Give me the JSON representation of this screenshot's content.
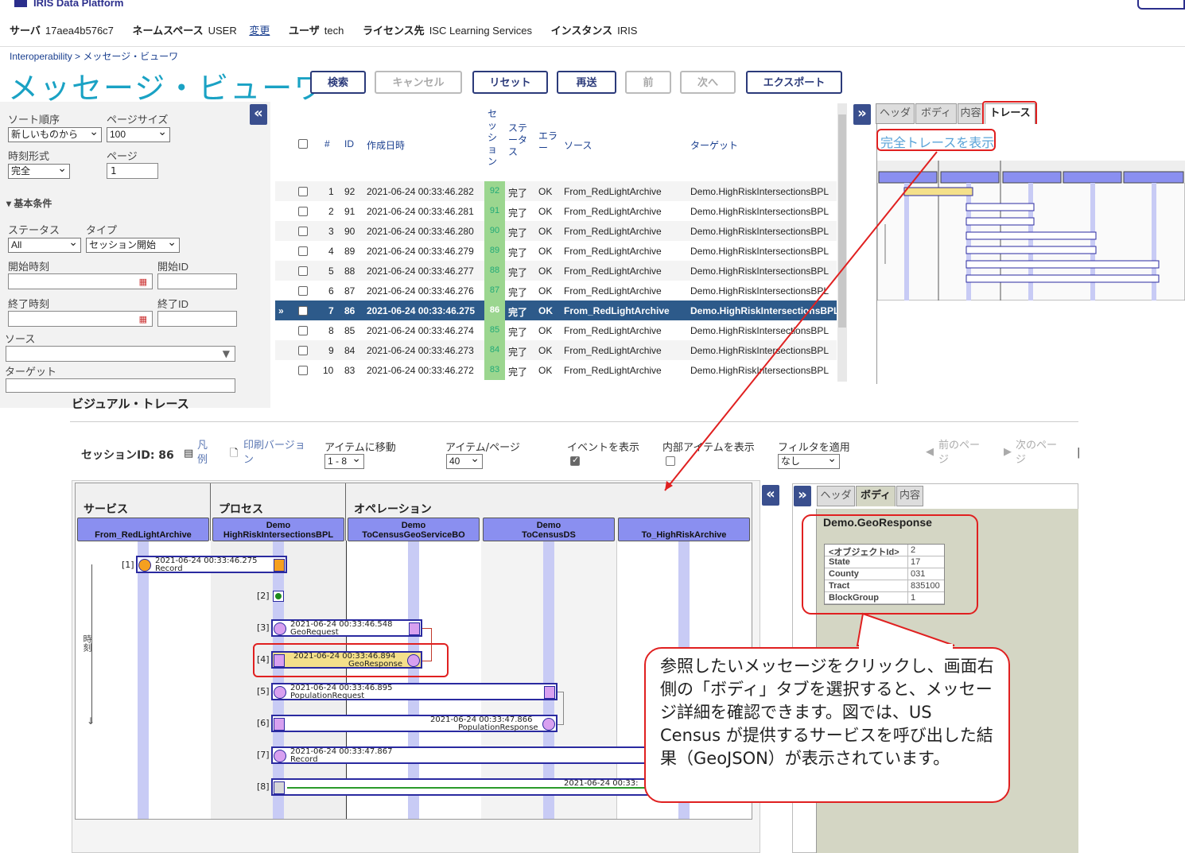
{
  "header": {
    "brand": "IRIS Data Platform",
    "server_label": "サーバ",
    "server": "17aea4b576c7",
    "namespace_label": "ネームスペース",
    "namespace": "USER",
    "change_link": "変更",
    "user_label": "ユーザ",
    "user": "tech",
    "license_label": "ライセンス先",
    "license": "ISC Learning Services",
    "instance_label": "インスタンス",
    "instance": "IRIS"
  },
  "breadcrumb": "Interoperability > メッセージ・ビューワ",
  "page_title": "メッセージ・ビューワ",
  "toolbar": {
    "search": "検索",
    "cancel": "キャンセル",
    "reset": "リセット",
    "resend": "再送",
    "prev": "前",
    "next": "次へ",
    "export": "エクスポート"
  },
  "filters": {
    "sort_label": "ソート順序",
    "sort_value": "新しいものから",
    "pagesize_label": "ページサイズ",
    "pagesize_value": "100",
    "timeformat_label": "時刻形式",
    "timeformat_value": "完全",
    "page_label": "ページ",
    "page_value": "1",
    "basic_section": "基本条件",
    "status_label": "ステータス",
    "status_value": "All",
    "type_label": "タイプ",
    "type_value": "セッション開始",
    "start_time_label": "開始時刻",
    "start_id_label": "開始ID",
    "end_time_label": "終了時刻",
    "end_id_label": "終了ID",
    "source_label": "ソース",
    "target_label": "ターゲット"
  },
  "table": {
    "headers": {
      "num": "#",
      "id": "ID",
      "created": "作成日時",
      "session": "セ ッ シ ョ ン",
      "status": "ステ ータ ス",
      "error": "エラ ー",
      "source": "ソース",
      "target": "ターゲット"
    },
    "rows": [
      {
        "num": "1",
        "id": "92",
        "time": "2021-06-24 00:33:46.282",
        "session": "92",
        "status": "完了",
        "error": "OK",
        "source": "From_RedLightArchive",
        "target": "Demo.HighRiskIntersectionsBPL"
      },
      {
        "num": "2",
        "id": "91",
        "time": "2021-06-24 00:33:46.281",
        "session": "91",
        "status": "完了",
        "error": "OK",
        "source": "From_RedLightArchive",
        "target": "Demo.HighRiskIntersectionsBPL"
      },
      {
        "num": "3",
        "id": "90",
        "time": "2021-06-24 00:33:46.280",
        "session": "90",
        "status": "完了",
        "error": "OK",
        "source": "From_RedLightArchive",
        "target": "Demo.HighRiskIntersectionsBPL"
      },
      {
        "num": "4",
        "id": "89",
        "time": "2021-06-24 00:33:46.279",
        "session": "89",
        "status": "完了",
        "error": "OK",
        "source": "From_RedLightArchive",
        "target": "Demo.HighRiskIntersectionsBPL"
      },
      {
        "num": "5",
        "id": "88",
        "time": "2021-06-24 00:33:46.277",
        "session": "88",
        "status": "完了",
        "error": "OK",
        "source": "From_RedLightArchive",
        "target": "Demo.HighRiskIntersectionsBPL"
      },
      {
        "num": "6",
        "id": "87",
        "time": "2021-06-24 00:33:46.276",
        "session": "87",
        "status": "完了",
        "error": "OK",
        "source": "From_RedLightArchive",
        "target": "Demo.HighRiskIntersectionsBPL"
      },
      {
        "num": "7",
        "id": "86",
        "time": "2021-06-24 00:33:46.275",
        "session": "86",
        "status": "完了",
        "error": "OK",
        "source": "From_RedLightArchive",
        "target": "Demo.HighRiskIntersectionsBPL",
        "selected": true
      },
      {
        "num": "8",
        "id": "85",
        "time": "2021-06-24 00:33:46.274",
        "session": "85",
        "status": "完了",
        "error": "OK",
        "source": "From_RedLightArchive",
        "target": "Demo.HighRiskIntersectionsBPL"
      },
      {
        "num": "9",
        "id": "84",
        "time": "2021-06-24 00:33:46.273",
        "session": "84",
        "status": "完了",
        "error": "OK",
        "source": "From_RedLightArchive",
        "target": "Demo.HighRiskIntersectionsBPL"
      },
      {
        "num": "10",
        "id": "83",
        "time": "2021-06-24 00:33:46.272",
        "session": "83",
        "status": "完了",
        "error": "OK",
        "source": "From_RedLightArchive",
        "target": "Demo.HighRiskIntersectionsBPL"
      }
    ],
    "selected_marker": "»"
  },
  "right_top": {
    "tabs": [
      "ヘッダ",
      "ボディ",
      "内容",
      "トレース"
    ],
    "full_trace_link": "完全トレースを表示"
  },
  "visual_trace": {
    "title": "ビジュアル・トレース",
    "session_label": "セッションID: 86",
    "legend": "凡例",
    "print": "印刷バージョン",
    "goto_label": "アイテムに移動",
    "goto_value": "1 - 8",
    "perpage_label": "アイテム/ページ",
    "perpage_value": "40",
    "events_label": "イベントを表示",
    "internal_label": "内部アイテムを表示",
    "filter_label": "フィルタを適用",
    "filter_value": "なし",
    "prev_page": "前のページ",
    "next_page": "次のページ",
    "columns": {
      "service": "サービス",
      "process": "プロセス",
      "operation": "オペレーション"
    },
    "actors": [
      {
        "line1": "",
        "line2": "From_RedLightArchive"
      },
      {
        "line1": "Demo",
        "line2": "HighRiskIntersectionsBPL"
      },
      {
        "line1": "Demo",
        "line2": "ToCensusGeoServiceBO"
      },
      {
        "line1": "Demo",
        "line2": "ToCensusDS"
      },
      {
        "line1": "",
        "line2": "To_HighRiskArchive"
      }
    ],
    "time_axis": "時刻",
    "messages": [
      {
        "idx": "[1]",
        "time": "2021-06-24 00:33:46.275",
        "name": "Record"
      },
      {
        "idx": "[2]",
        "time": "",
        "name": ""
      },
      {
        "idx": "[3]",
        "time": "2021-06-24 00:33:46.548",
        "name": "GeoRequest"
      },
      {
        "idx": "[4]",
        "time": "2021-06-24 00:33:46.894",
        "name": "GeoResponse"
      },
      {
        "idx": "[5]",
        "time": "2021-06-24 00:33:46.895",
        "name": "PopulationRequest"
      },
      {
        "idx": "[6]",
        "time": "2021-06-24 00:33:47.866",
        "name": "PopulationResponse"
      },
      {
        "idx": "[7]",
        "time": "2021-06-24 00:33:47.867",
        "name": "Record"
      },
      {
        "idx": "[8]",
        "time": "2021-06-24 00:33:",
        "name": ""
      }
    ]
  },
  "right_bottom": {
    "tabs": [
      "ヘッダ",
      "ボディ",
      "内容"
    ],
    "object_title": "Demo.GeoResponse",
    "fields": [
      {
        "key": "<オブジェクトId>",
        "value": "2"
      },
      {
        "key": "State",
        "value": "17"
      },
      {
        "key": "County",
        "value": "031"
      },
      {
        "key": "Tract",
        "value": "835100"
      },
      {
        "key": "BlockGroup",
        "value": "1"
      }
    ]
  },
  "callout": "参照したいメッセージをクリックし、画面右側の「ボディ」タブを選択すると、メッセージ詳細を確認できます。図では、US Census が提供するサービスを呼び出した結果（GeoJSON）が表示されています。",
  "colors": {
    "accent": "#1aa2c4",
    "button": "#2b3a7a",
    "selected_row": "#2d5a8a",
    "callout": "#e02020",
    "lane": "#c8cbf5"
  }
}
